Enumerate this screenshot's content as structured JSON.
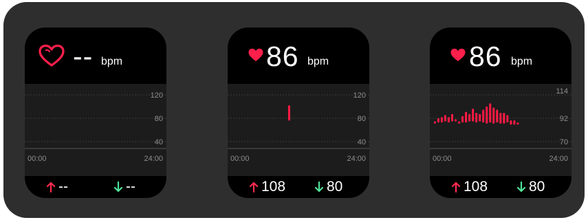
{
  "colors": {
    "panel": "#2e2e2e",
    "watch_bg": "#000000",
    "chart_bg": "#1c1c1c",
    "heart": "#ff1f4b",
    "bar": "#ff1a44",
    "max_arrow": "#ff2b4f",
    "min_arrow": "#4fe39a",
    "axis_text": "#8d8d8d"
  },
  "watches": [
    {
      "heart_icon": "heart-outline-icon",
      "hr_value": "--",
      "hr_unit": "bpm",
      "y_ticks": [
        "120",
        "80",
        "40"
      ],
      "x_start": "00:00",
      "x_end": "24:00",
      "max_value": "--",
      "min_value": "--"
    },
    {
      "heart_icon": "heart-filled-icon",
      "hr_value": "86",
      "hr_unit": "bpm",
      "y_ticks": [
        "120",
        "80",
        "40"
      ],
      "x_start": "00:00",
      "x_end": "24:00",
      "max_value": "108",
      "min_value": "80"
    },
    {
      "heart_icon": "heart-filled-icon",
      "hr_value": "86",
      "hr_unit": "bpm",
      "y_ticks": [
        "114",
        "92",
        "70"
      ],
      "x_start": "00:00",
      "x_end": "24:00",
      "max_value": "108",
      "min_value": "80"
    }
  ],
  "chart_data": [
    {
      "type": "bar",
      "ylim": [
        40,
        120
      ],
      "xlim": [
        0,
        24
      ],
      "x_ticks": [
        "00:00",
        "24:00"
      ],
      "y_ticks": [
        120,
        80,
        40
      ],
      "bars": []
    },
    {
      "type": "bar",
      "ylim": [
        40,
        120
      ],
      "xlim": [
        0,
        24
      ],
      "x_ticks": [
        "00:00",
        "24:00"
      ],
      "y_ticks": [
        120,
        80,
        40
      ],
      "bars": [
        {
          "x": 10.2,
          "low": 76,
          "high": 102
        }
      ]
    },
    {
      "type": "bar",
      "ylim": [
        70,
        114
      ],
      "xlim": [
        0,
        24
      ],
      "x_ticks": [
        "00:00",
        "24:00"
      ],
      "y_ticks": [
        114,
        92,
        70
      ],
      "bars": [
        {
          "x": 0.4,
          "low": 87,
          "high": 89
        },
        {
          "x": 1.0,
          "low": 88,
          "high": 92
        },
        {
          "x": 1.6,
          "low": 88,
          "high": 93
        },
        {
          "x": 2.2,
          "low": 89,
          "high": 95
        },
        {
          "x": 2.8,
          "low": 88,
          "high": 93
        },
        {
          "x": 3.4,
          "low": 89,
          "high": 96
        },
        {
          "x": 4.0,
          "low": 89,
          "high": 91
        },
        {
          "x": 4.6,
          "low": 87,
          "high": 89
        },
        {
          "x": 5.2,
          "low": 88,
          "high": 94
        },
        {
          "x": 5.8,
          "low": 88,
          "high": 98
        },
        {
          "x": 6.4,
          "low": 89,
          "high": 96
        },
        {
          "x": 7.0,
          "low": 89,
          "high": 101
        },
        {
          "x": 7.6,
          "low": 88,
          "high": 97
        },
        {
          "x": 8.2,
          "low": 89,
          "high": 96
        },
        {
          "x": 8.8,
          "low": 88,
          "high": 100
        },
        {
          "x": 9.4,
          "low": 87,
          "high": 103
        },
        {
          "x": 10.0,
          "low": 88,
          "high": 106
        },
        {
          "x": 10.6,
          "low": 87,
          "high": 102
        },
        {
          "x": 11.2,
          "low": 88,
          "high": 100
        },
        {
          "x": 11.8,
          "low": 87,
          "high": 97
        },
        {
          "x": 12.4,
          "low": 87,
          "high": 97
        },
        {
          "x": 13.0,
          "low": 88,
          "high": 95
        },
        {
          "x": 13.6,
          "low": 86,
          "high": 90
        },
        {
          "x": 14.2,
          "low": 86,
          "high": 90
        },
        {
          "x": 14.8,
          "low": 86,
          "high": 88
        }
      ]
    }
  ]
}
